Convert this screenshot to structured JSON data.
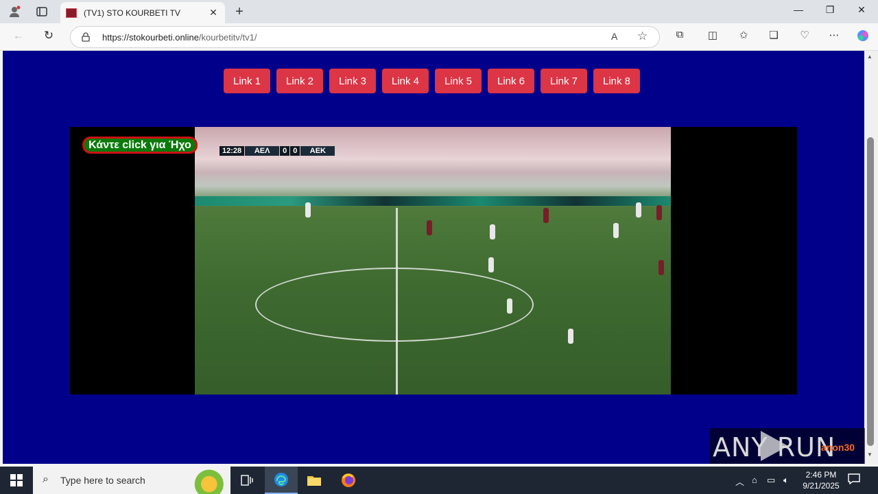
{
  "browser": {
    "tab_title": "(TV1) STO KOURBETI TV",
    "url_host": "https://stokourbeti.online",
    "url_path": "/kourbetitv/tv1/"
  },
  "page": {
    "links": [
      "Link 1",
      "Link 2",
      "Link 3",
      "Link 4",
      "Link 5",
      "Link 6",
      "Link 7",
      "Link 8"
    ],
    "sound_button": "Κάντε click για Ήχο",
    "scoreboard": {
      "time": "12:28",
      "home": "ΑΕΛ",
      "home_score": "0",
      "away_score": "0",
      "away": "ΑΕΚ"
    }
  },
  "watermark": {
    "brand": "ANY RUN",
    "user": "anon30"
  },
  "taskbar": {
    "search_placeholder": "Type here to search",
    "time": "2:46 PM",
    "date": "9/21/2025"
  },
  "colors": {
    "page_bg": "#00008b",
    "link_button": "#dc3545",
    "sound_button_bg": "#0a7a0a",
    "sound_button_border": "#cc1111"
  }
}
